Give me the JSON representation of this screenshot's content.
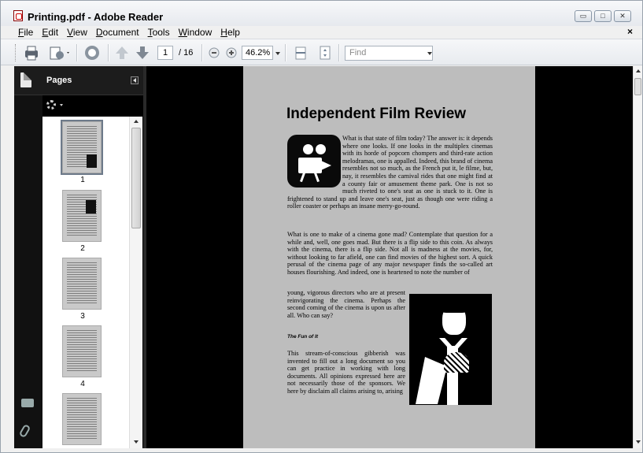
{
  "window": {
    "title": "Printing.pdf - Adobe Reader",
    "controls": [
      "minimize",
      "maximize",
      "close"
    ]
  },
  "menu": {
    "items": [
      "File",
      "Edit",
      "View",
      "Document",
      "Tools",
      "Window",
      "Help"
    ],
    "doc_close": "×"
  },
  "toolbar": {
    "page_current": "1",
    "page_total": "/ 16",
    "zoom": "46.2%",
    "find_placeholder": "Find",
    "icons": [
      "print-icon",
      "share-icon",
      "hand-tool-icon",
      "previous-page-icon",
      "next-page-icon",
      "zoom-out-icon",
      "zoom-in-icon",
      "fit-width-icon",
      "fit-page-icon"
    ]
  },
  "nav_pane": {
    "label": "Pages",
    "thumbnails": [
      {
        "label": "1",
        "selected": true
      },
      {
        "label": "2",
        "selected": false
      },
      {
        "label": "3",
        "selected": false
      },
      {
        "label": "4",
        "selected": false
      },
      {
        "label": "",
        "selected": false
      }
    ]
  },
  "document": {
    "title": "Independent Film Review",
    "paragraph1": "What is that state of film today? The answer is: it depends where one looks. If one looks in the multiplex cinemas with its horde of popcorn chompers and third-rate action melodramas, one is appalled. Indeed, this brand of cinema resembles not so much, as the French put it, le filme, but, nay, it resembles the carnival rides that one might find at a county fair or amusement theme park. One is not so much riveted to one's seat as one is stuck to it. One is frightened to stand up and leave one's seat, just as though one were riding a roller coaster or perhaps an insane merry-go-round.",
    "paragraph2": "What is one to make of a cinema gone mad? Contemplate that question for a while and, well, one goes mad. But there is a flip side to this coin. As always with the cinema, there is a flip side. Not all is madness at the movies, for, without looking to far afield, one can find movies of the highest sort. A quick perusal of the cinema page of any major newspaper finds the so-called art houses flourishing. And indeed, one is heartened to note the number of",
    "paragraph3": "young, vigorous directors who are at present reinvigorating the cinema. Perhaps the second coming of the cinema is upon us after all. Who can say?",
    "subheading": "The Fun of It",
    "paragraph4": "This stream-of-conscious gibberish was invented to fill out a long document so you can get practice in working with long documents. All opinions expressed here are not necessarily those of the sponsors. We here by disclaim all claims arising to, arising"
  }
}
